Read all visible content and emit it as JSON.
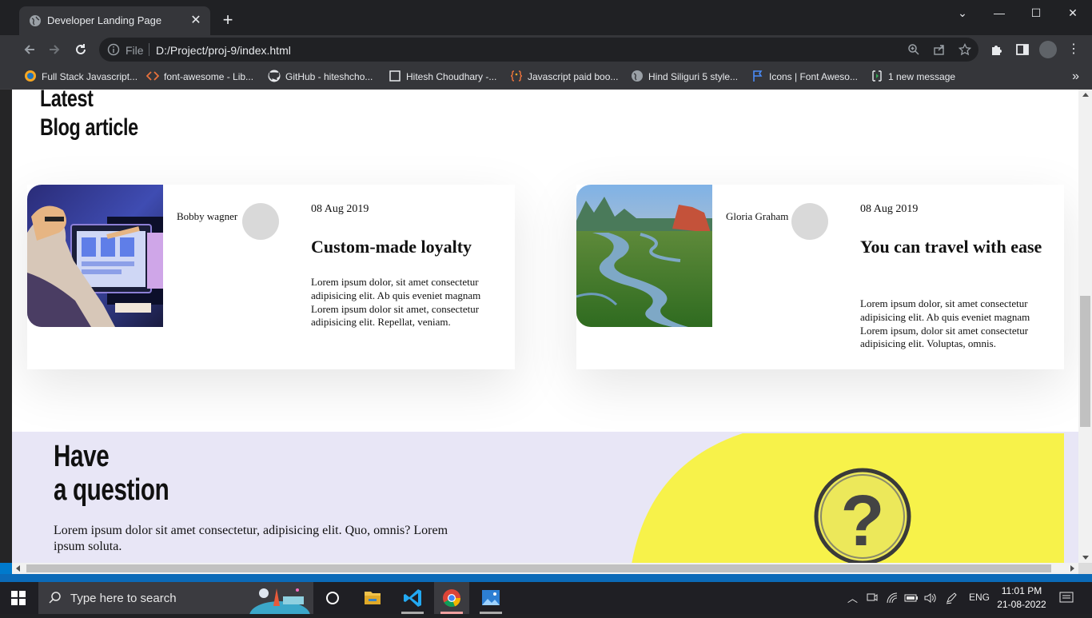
{
  "browser": {
    "tab": {
      "title": "Developer Landing Page",
      "close": "✕"
    },
    "new_tab": "+",
    "window_controls": {
      "minimize": "—",
      "maximize": "☐",
      "close": "✕",
      "tabsearch": "⌄"
    },
    "address": {
      "scheme": "File",
      "url": "D:/Project/proj-9/index.html"
    },
    "bookmarks": [
      {
        "label": "Full Stack Javascript...",
        "icon": "orange-circle-icon"
      },
      {
        "label": "font-awesome - Lib...",
        "icon": "code-brackets-icon"
      },
      {
        "label": "GitHub - hiteshcho...",
        "icon": "github-icon"
      },
      {
        "label": "Hitesh Choudhary -...",
        "icon": "square-icon"
      },
      {
        "label": "Javascript paid boo...",
        "icon": "braces-icon"
      },
      {
        "label": "Hind Siliguri 5 style...",
        "icon": "globe-icon"
      },
      {
        "label": "Icons | Font Aweso...",
        "icon": "flag-icon"
      },
      {
        "label": "1 new message",
        "icon": "message-icon"
      }
    ],
    "bookmarks_more": "»"
  },
  "page": {
    "blog_heading": {
      "line1": "Latest",
      "line2": "Blog article"
    },
    "cards": [
      {
        "author": "Bobby wagner",
        "date": "08 Aug 2019",
        "title": "Custom-made loyalty",
        "excerpt": "Lorem ipsum dolor, sit amet consectetur adipisicing elit. Ab quis eveniet magnam Lorem ipsum dolor sit amet, consectetur adipisicing elit. Repellat, veniam.",
        "image": "developer-at-computer-photo"
      },
      {
        "author": "Gloria Graham",
        "date": "08 Aug 2019",
        "title": "You can travel with ease",
        "excerpt": "Lorem ipsum dolor, sit amet consectetur adipisicing elit. Ab quis eveniet magnam Lorem ipsum, dolor sit amet consectetur adipisicing elit. Voluptas, omnis.",
        "image": "river-landscape-photo"
      }
    ],
    "question": {
      "heading_line1": "Have",
      "heading_line2": "a question",
      "text": "Lorem ipsum dolor sit amet consectetur, adipisicing elit. Quo, omnis? Lorem ipsum soluta.",
      "image": "magnifier-question-mark-photo"
    }
  },
  "taskbar": {
    "search_placeholder": "Type here to search",
    "language": "ENG",
    "time": "11:01 PM",
    "date": "21-08-2022"
  },
  "colors": {
    "question_bg": "#e8e6f6",
    "question_yellow": "#f7f24a",
    "avatar": "#d9d9d9",
    "browser_dark": "#202124",
    "browser_toolbar": "#35363a"
  }
}
